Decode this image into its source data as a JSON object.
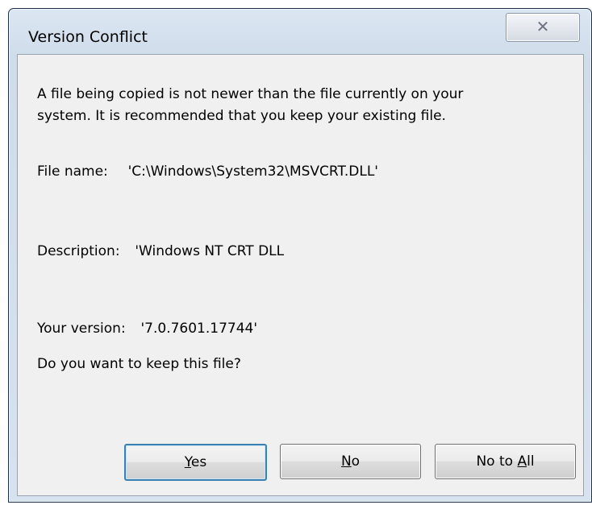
{
  "window": {
    "title": "Version Conflict"
  },
  "message": {
    "line1": "A file being copied is not newer than the file currently on your",
    "line2": "system. It is recommended that you keep your existing file."
  },
  "details": {
    "file_name_label": "File name:",
    "file_name_value": "'C:\\Windows\\System32\\MSVCRT.DLL'",
    "description_label": "Description:",
    "description_value": "'Windows NT CRT DLL",
    "version_label": "Your version:",
    "version_value": "'7.0.7601.17744'"
  },
  "question": "Do you want to keep this file?",
  "buttons": {
    "yes": {
      "prefix": "",
      "accel": "Y",
      "suffix": "es"
    },
    "no": {
      "prefix": "",
      "accel": "N",
      "suffix": "o"
    },
    "no_to_all": {
      "prefix": "No to ",
      "accel": "A",
      "suffix": "ll"
    }
  },
  "icons": {
    "close": "close-icon"
  }
}
